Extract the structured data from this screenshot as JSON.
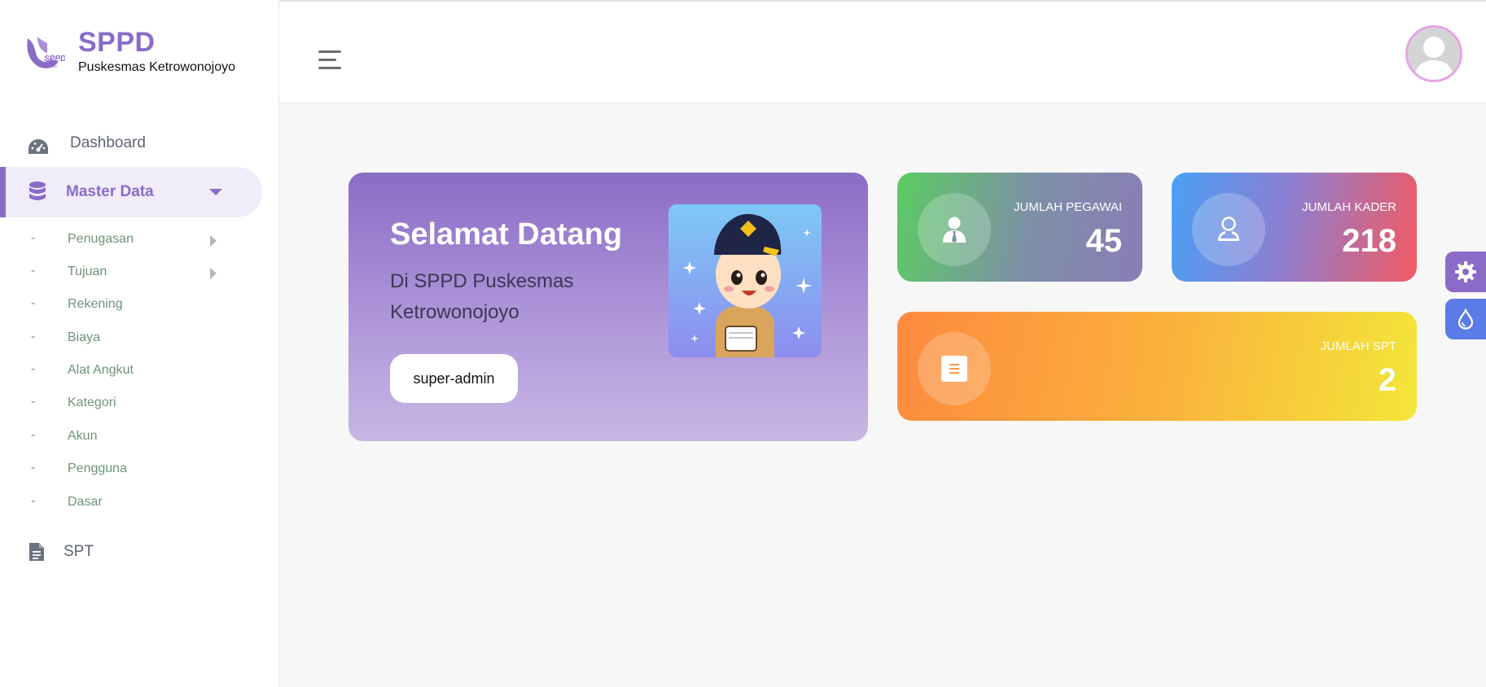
{
  "brand": {
    "title": "SPPD",
    "subtitle": "Puskesmas Ketrowonojoyo",
    "logo_text": "SPPD",
    "logo_small": "ONLINE"
  },
  "colors": {
    "primary": "#8a6cc8",
    "background": "#f7f7f7",
    "submenu_text": "#6c9478"
  },
  "sidebar": {
    "items": [
      {
        "label": "Dashboard",
        "icon": "dashboard-gauge-icon",
        "active": false
      },
      {
        "label": "Master Data",
        "icon": "database-icon",
        "active": true,
        "expanded": true
      },
      {
        "label": "SPT",
        "icon": "document-icon",
        "active": false
      }
    ],
    "master_data_children": [
      {
        "label": "Penugasan",
        "has_submenu": true
      },
      {
        "label": "Tujuan",
        "has_submenu": true
      },
      {
        "label": "Rekening",
        "has_submenu": false
      },
      {
        "label": "Biaya",
        "has_submenu": false
      },
      {
        "label": "Alat Angkut",
        "has_submenu": false
      },
      {
        "label": "Kategori",
        "has_submenu": false
      },
      {
        "label": "Akun",
        "has_submenu": false
      },
      {
        "label": "Pengguna",
        "has_submenu": false
      },
      {
        "label": "Dasar",
        "has_submenu": false
      }
    ],
    "bullet": "-"
  },
  "topbar": {
    "menu_icon": "hamburger-menu-icon",
    "avatar_icon": "user-avatar-icon"
  },
  "welcome": {
    "title": "Selamat Datang",
    "subtitle": "Di SPPD Puskesmas Ketrowonojoyo",
    "role": "super-admin"
  },
  "stats": [
    {
      "label": "JUMLAH PEGAWAI",
      "value": "45",
      "icon": "employee-icon"
    },
    {
      "label": "JUMLAH KADER",
      "value": "218",
      "icon": "person-outline-icon"
    },
    {
      "label": "JUMLAH SPT",
      "value": "2",
      "icon": "document-list-icon"
    }
  ],
  "floating": [
    {
      "icon": "gear-icon"
    },
    {
      "icon": "water-drop-icon"
    }
  ]
}
